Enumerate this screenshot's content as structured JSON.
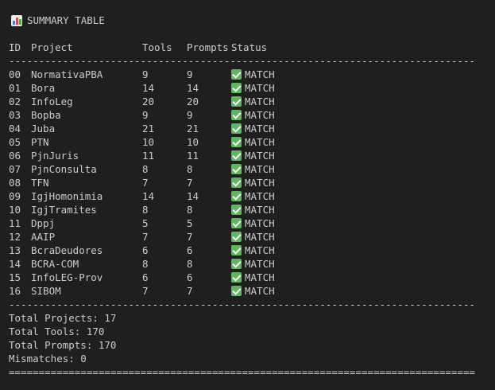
{
  "title": "SUMMARY TABLE",
  "title_icon": "bar-chart-icon",
  "headers": {
    "id": "ID",
    "project": "Project",
    "tools": "Tools",
    "prompts": "Prompts",
    "status": "Status"
  },
  "separator_dash": "------------------------------------------------------------------------------",
  "separator_eq": "==============================================================================",
  "rows": [
    {
      "id": "00",
      "project": "NormativaPBA",
      "tools": "9",
      "prompts": "9",
      "status": "MATCH"
    },
    {
      "id": "01",
      "project": "Bora",
      "tools": "14",
      "prompts": "14",
      "status": "MATCH"
    },
    {
      "id": "02",
      "project": "InfoLeg",
      "tools": "20",
      "prompts": "20",
      "status": "MATCH"
    },
    {
      "id": "03",
      "project": "Bopba",
      "tools": "9",
      "prompts": "9",
      "status": "MATCH"
    },
    {
      "id": "04",
      "project": "Juba",
      "tools": "21",
      "prompts": "21",
      "status": "MATCH"
    },
    {
      "id": "05",
      "project": "PTN",
      "tools": "10",
      "prompts": "10",
      "status": "MATCH"
    },
    {
      "id": "06",
      "project": "PjnJuris",
      "tools": "11",
      "prompts": "11",
      "status": "MATCH"
    },
    {
      "id": "07",
      "project": "PjnConsulta",
      "tools": "8",
      "prompts": "8",
      "status": "MATCH"
    },
    {
      "id": "08",
      "project": "TFN",
      "tools": "7",
      "prompts": "7",
      "status": "MATCH"
    },
    {
      "id": "09",
      "project": "IgjHomonimia",
      "tools": "14",
      "prompts": "14",
      "status": "MATCH"
    },
    {
      "id": "10",
      "project": "IgjTramites",
      "tools": "8",
      "prompts": "8",
      "status": "MATCH"
    },
    {
      "id": "11",
      "project": "Dppj",
      "tools": "5",
      "prompts": "5",
      "status": "MATCH"
    },
    {
      "id": "12",
      "project": "AAIP",
      "tools": "7",
      "prompts": "7",
      "status": "MATCH"
    },
    {
      "id": "13",
      "project": "BcraDeudores",
      "tools": "6",
      "prompts": "6",
      "status": "MATCH"
    },
    {
      "id": "14",
      "project": "BCRA-COM",
      "tools": "8",
      "prompts": "8",
      "status": "MATCH"
    },
    {
      "id": "15",
      "project": "InfoLEG-Prov",
      "tools": "6",
      "prompts": "6",
      "status": "MATCH"
    },
    {
      "id": "16",
      "project": "SIBOM",
      "tools": "7",
      "prompts": "7",
      "status": "MATCH"
    }
  ],
  "status_icon": "check-mark-icon",
  "colors": {
    "background": "#1f1f1f",
    "text": "#cccccc",
    "check": "#5cb85c"
  },
  "totals": {
    "projects": "Total Projects: 17",
    "tools": "Total Tools: 170",
    "prompts": "Total Prompts: 170",
    "mismatches": "Mismatches: 0"
  }
}
